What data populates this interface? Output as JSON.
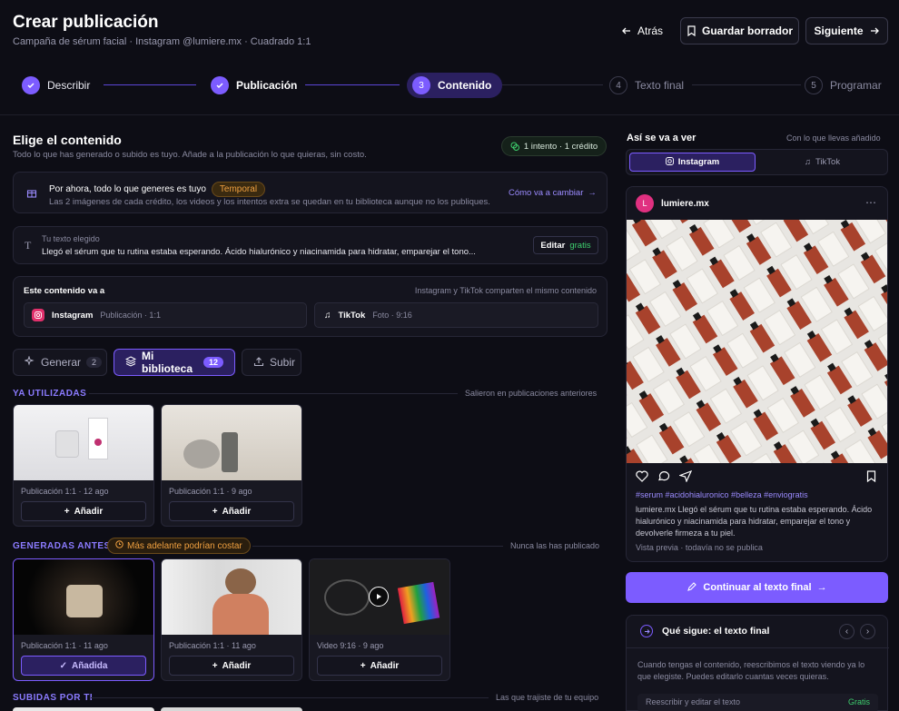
{
  "header": {
    "title": "Crear publicación",
    "subtitle": "Campaña de sérum facial · Instagram @lumiere.mx · Cuadrado 1:1",
    "back_label": "Atrás",
    "save_label": "Guardar borrador",
    "next_label": "Siguiente"
  },
  "steps": [
    {
      "num": "",
      "label": "Describir",
      "state": "done"
    },
    {
      "num": "",
      "label": "Publicación",
      "state": "done"
    },
    {
      "num": "3",
      "label": "Contenido",
      "state": "active"
    },
    {
      "num": "4",
      "label": "Texto final",
      "state": "todo"
    },
    {
      "num": "5",
      "label": "Programar",
      "state": "todo"
    }
  ],
  "content": {
    "title": "Elige el contenido",
    "description": "Todo lo que has generado o subido es tuyo. Añade a la publicación lo que quieras, sin costo.",
    "credits_badge": "1 intento · 1 crédito",
    "notice": {
      "title": "Por ahora, todo lo que generes es tuyo",
      "tag": "Temporal",
      "body": "Las 2 imágenes de cada crédito, los videos y los intentos extra se quedan en tu biblioteca aunque no los publiques.",
      "link": "Cómo va a cambiar"
    },
    "chosen_text": {
      "label": "Tu texto elegido",
      "text": "Llegó el sérum que tu rutina estaba esperando. Ácido hialurónico y niacinamida para hidratar, emparejar el tono...",
      "edit_label": "Editar",
      "edit_tag": "gratis"
    },
    "destination": {
      "title": "Este contenido va a",
      "note": "Instagram y TikTok comparten el mismo contenido",
      "platforms": [
        {
          "name": "Instagram",
          "detail": "Publicación · 1:1"
        },
        {
          "name": "TikTok",
          "detail": "Foto · 9:16"
        }
      ]
    },
    "tabs": {
      "generate": "Generar",
      "generate_count": "2",
      "library": "Mi biblioteca",
      "library_count": "12",
      "upload": "Subir"
    },
    "used": {
      "label": "YA UTILIZADAS",
      "note": "Salieron en publicaciones anteriores",
      "items": [
        {
          "meta": "Publicación 1:1 · 12 ago",
          "action": "Añadir"
        },
        {
          "meta": "Publicación 1:1 · 9 ago",
          "action": "Añadir"
        }
      ]
    },
    "generated": {
      "label": "GENERADAS ANTES",
      "tag": "Más adelante podrían costar",
      "note": "Nunca las has publicado",
      "items": [
        {
          "meta": "Publicación 1:1 · 11 ago",
          "action": "Añadida"
        },
        {
          "meta": "Publicación 1:1 · 11 ago",
          "action": "Añadir"
        },
        {
          "meta": "Video 9:16 · 9 ago",
          "action": "Añadir"
        }
      ]
    },
    "uploaded": {
      "label": "SUBIDAS POR TI",
      "note": "Las que trajiste de tu equipo"
    }
  },
  "preview": {
    "title": "Así se va a ver",
    "note": "Con lo que llevas añadido",
    "tabs": [
      "Instagram",
      "TikTok"
    ],
    "account": "lumiere.mx",
    "avatar_letter": "L",
    "hashtags": "#serum #acidohialuronico #belleza #enviogratis",
    "caption_user": "lumiere.mx",
    "caption": "Llegó el sérum que tu rutina estaba esperando. Ácido hialurónico y niacinamida para hidratar, emparejar el tono y devolverle firmeza a tu piel.",
    "footer": "Vista previa · todavía no se publica",
    "cta": "Continuar al texto final"
  },
  "next_step": {
    "title": "Qué sigue: el texto final",
    "body": "Cuando tengas el contenido, reescribimos el texto viendo ya lo que elegiste. Puedes editarlo cuantas veces quieras.",
    "row_label": "Reescribir y editar el texto",
    "row_tag": "Gratis"
  },
  "colors": {
    "accent": "#7c5cff",
    "accent_dark": "#2b2060",
    "bg": "#0d0d15",
    "panel": "#14141e",
    "warning": "#f0a040",
    "success": "#3ecf6e"
  }
}
